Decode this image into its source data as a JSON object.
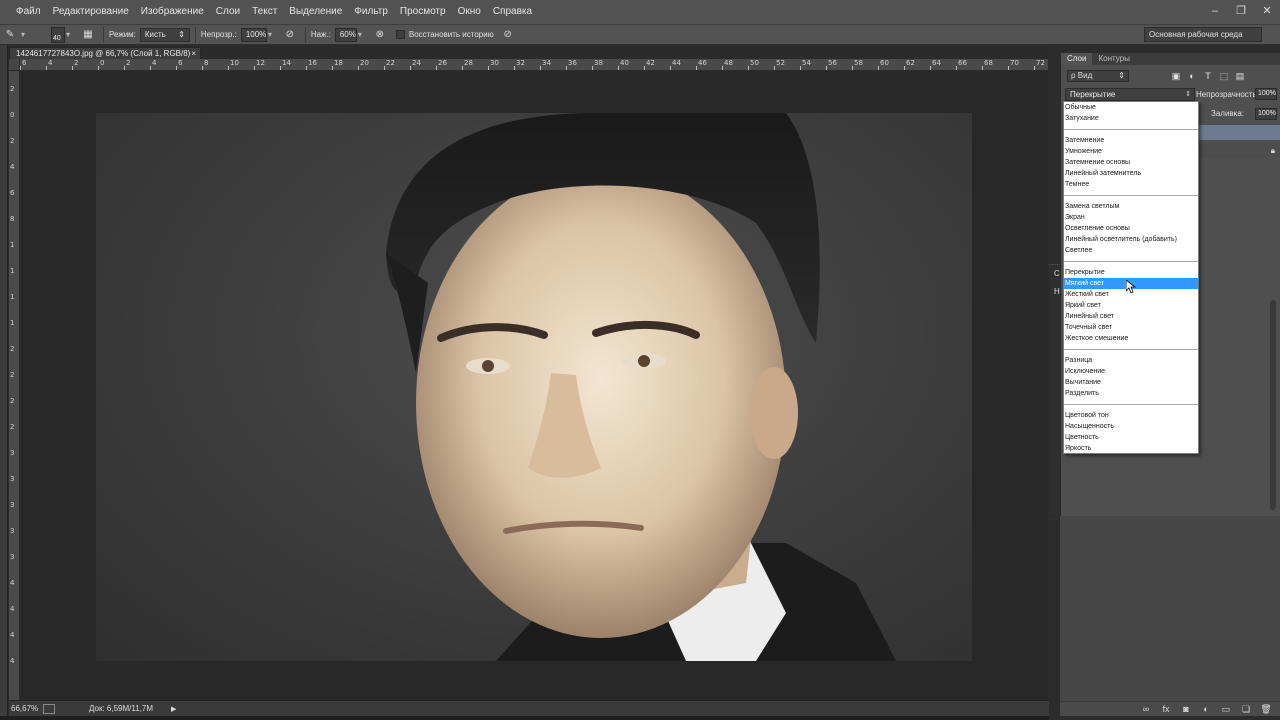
{
  "menu": [
    "Файл",
    "Редактирование",
    "Изображение",
    "Слои",
    "Текст",
    "Выделение",
    "Фильтр",
    "Просмотр",
    "Окно",
    "Справка"
  ],
  "options": {
    "brush_size": "40",
    "mode_label": "Режим:",
    "mode_value": "Кисть",
    "opacity_label": "Непрозр.:",
    "opacity_value": "100%",
    "flow_label": "Наж.:",
    "flow_value": "60%",
    "restore_history_label": "Восстановить историю",
    "workspace": "Основная рабочая среда"
  },
  "document": {
    "tab_title": "1424617727843O.jpg @ 66,7% (Слой 1, RGB/8) *",
    "tab_close": "×",
    "ruler_top_labels": [
      "6",
      "4",
      "2",
      "0",
      "2",
      "4",
      "6",
      "8",
      "10",
      "12",
      "14",
      "16",
      "18",
      "20",
      "22",
      "24",
      "26",
      "28",
      "30",
      "32",
      "34",
      "36",
      "38",
      "40",
      "42",
      "44",
      "46",
      "48",
      "50",
      "52",
      "54",
      "56",
      "58",
      "60",
      "62",
      "64",
      "66",
      "68",
      "70",
      "72"
    ],
    "ruler_left_labels": [
      "2",
      "0",
      "2",
      "4",
      "6",
      "8",
      "1",
      "1",
      "1",
      "1",
      "2",
      "2",
      "2",
      "2",
      "3",
      "3",
      "3",
      "3",
      "3",
      "4",
      "4",
      "4",
      "4"
    ]
  },
  "status": {
    "zoom": "66,67%",
    "doc_info": "Док: 6,59М/11,7М",
    "arrow": "▶"
  },
  "layers_panel": {
    "tabs": [
      "Слои",
      "Контуры"
    ],
    "filter_label": "ρ Вид",
    "blend_mode": "Перекрытие",
    "opacity_label": "Непрозрачность:",
    "opacity_value": "100%",
    "fill_label": "Заливка:",
    "fill_value": "100%",
    "second_panel_title": "Сво",
    "second_panel_tab": "Не"
  },
  "blend_modes": [
    {
      "label": "Обычные"
    },
    {
      "label": "Затухание"
    },
    {
      "divider": true
    },
    {
      "label": "Затемнение"
    },
    {
      "label": "Умножение"
    },
    {
      "label": "Затемнение основы"
    },
    {
      "label": "Линейный затемнитель"
    },
    {
      "label": "Темнее"
    },
    {
      "divider": true
    },
    {
      "label": "Замена светлым"
    },
    {
      "label": "Экран"
    },
    {
      "label": "Осветление основы"
    },
    {
      "label": "Линейный осветлитель (добавить)"
    },
    {
      "label": "Светлее"
    },
    {
      "divider": true
    },
    {
      "label": "Перекрытие"
    },
    {
      "label": "Мягкий свет",
      "selected": true
    },
    {
      "label": "Жесткий свет"
    },
    {
      "label": "Яркий свет"
    },
    {
      "label": "Линейный свет"
    },
    {
      "label": "Точечный свет"
    },
    {
      "label": "Жесткое смешение"
    },
    {
      "divider": true
    },
    {
      "label": "Разница"
    },
    {
      "label": "Исключение"
    },
    {
      "label": "Вычитание"
    },
    {
      "label": "Разделить"
    },
    {
      "divider": true
    },
    {
      "label": "Цветовой тон"
    },
    {
      "label": "Насыщенность"
    },
    {
      "label": "Цветность"
    },
    {
      "label": "Яркость"
    }
  ],
  "colors": {
    "selected_highlight": "#3399ff",
    "chrome": "#535353",
    "canvas_bg": "#282828"
  }
}
